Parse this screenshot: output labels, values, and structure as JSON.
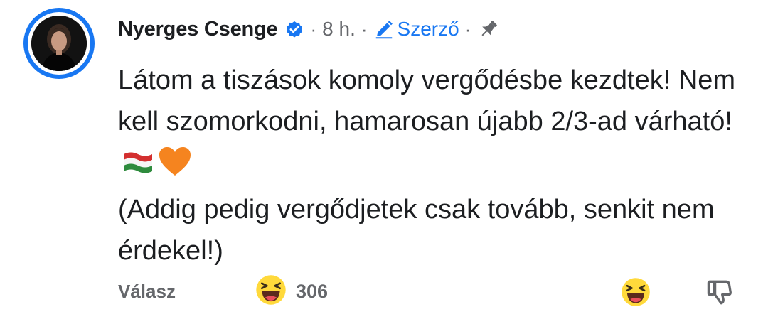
{
  "comment": {
    "author": "Nyerges Csenge",
    "verified_icon": "verified-badge-icon",
    "separator": "·",
    "time": "8 h.",
    "badge": "Szerző",
    "badge_icon": "pencil-icon",
    "pin_icon": "pin-icon",
    "lines": [
      "Látom a tiszások komoly vergődésbe kezdtek! Nem kell szomorkodni, hamarosan újabb 2/3-ad várható!",
      "(Addig pedig vergődjetek csak tovább, senkit nem érdekel!)"
    ],
    "inline_emojis": [
      "hungarian-flag-emoji",
      "orange-heart-emoji"
    ]
  },
  "footer": {
    "reply_label": "Válasz",
    "reaction_icon": "laughing-emoji-icon",
    "reaction_count": "306",
    "react_icon": "laughing-emoji-icon",
    "dislike_icon": "thumbs-down-icon"
  },
  "colors": {
    "accent": "#1877f2",
    "secondary_text": "#65676b",
    "text": "#1c1e21",
    "heart": "#f5841f",
    "emoji_face": "#ffd93b"
  }
}
